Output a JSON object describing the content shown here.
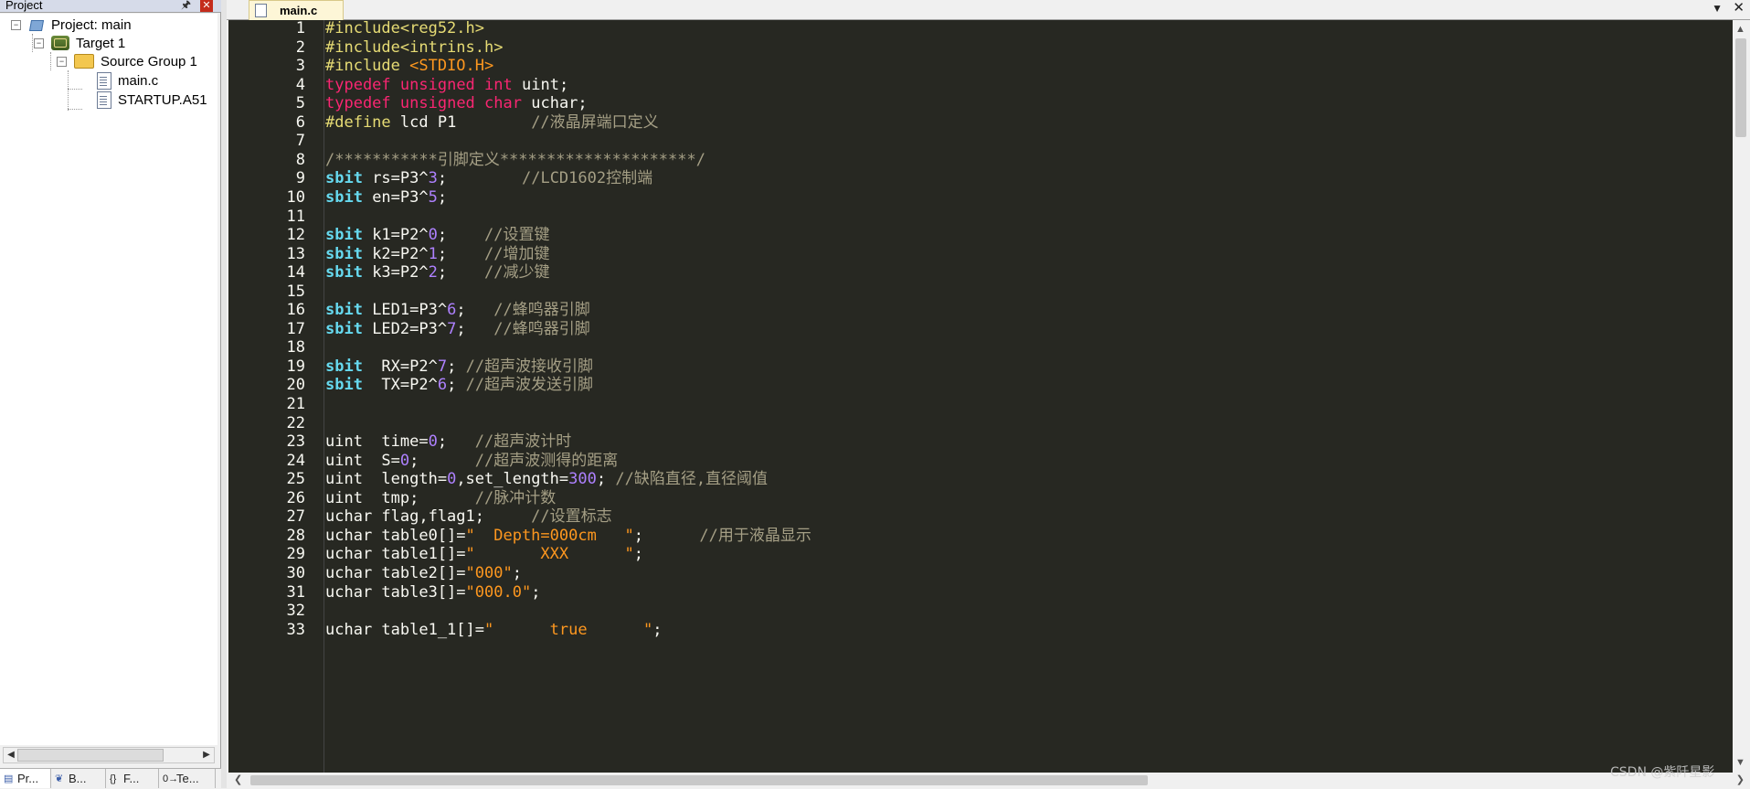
{
  "project_pane": {
    "title": "Project",
    "pin_icon": "pin-icon",
    "close_icon": "close-icon",
    "tree": {
      "root": "Project: main",
      "target": "Target 1",
      "group": "Source Group 1",
      "files": [
        "main.c",
        "STARTUP.A51"
      ]
    },
    "tabs": [
      {
        "label": "Pr...",
        "icon": "project-icon"
      },
      {
        "label": "B...",
        "icon": "books-icon"
      },
      {
        "label": "F...",
        "icon": "functions-icon"
      },
      {
        "label": "Te...",
        "icon": "templates-icon"
      }
    ]
  },
  "editor": {
    "active_tab": "main.c",
    "lines": [
      [
        [
          "pp",
          "#include<reg52.h>"
        ]
      ],
      [
        [
          "pp",
          "#include<intrins.h>"
        ]
      ],
      [
        [
          "pp",
          "#include "
        ],
        [
          "st",
          "<STDIO.H>"
        ]
      ],
      [
        [
          "kw",
          "typedef"
        ],
        [
          "tx",
          " "
        ],
        [
          "kw",
          "unsigned"
        ],
        [
          "tx",
          " "
        ],
        [
          "kw",
          "int"
        ],
        [
          "tx",
          " uint;"
        ]
      ],
      [
        [
          "kw",
          "typedef"
        ],
        [
          "tx",
          " "
        ],
        [
          "kw",
          "unsigned"
        ],
        [
          "tx",
          " "
        ],
        [
          "kw",
          "char"
        ],
        [
          "tx",
          " uchar;"
        ]
      ],
      [
        [
          "pp",
          "#define"
        ],
        [
          "tx",
          " lcd P1        "
        ],
        [
          "cm",
          "//液晶屏端口定义"
        ]
      ],
      [],
      [
        [
          "cm",
          "/***********引脚定义*********************/"
        ]
      ],
      [
        [
          "sb",
          "sbit"
        ],
        [
          "tx",
          " rs=P3^"
        ],
        [
          "nm",
          "3"
        ],
        [
          "tx",
          ";        "
        ],
        [
          "cm",
          "//LCD1602控制端"
        ]
      ],
      [
        [
          "sb",
          "sbit"
        ],
        [
          "tx",
          " en=P3^"
        ],
        [
          "nm",
          "5"
        ],
        [
          "tx",
          ";"
        ]
      ],
      [],
      [
        [
          "sb",
          "sbit"
        ],
        [
          "tx",
          " k1=P2^"
        ],
        [
          "nm",
          "0"
        ],
        [
          "tx",
          ";    "
        ],
        [
          "cm",
          "//设置键"
        ]
      ],
      [
        [
          "sb",
          "sbit"
        ],
        [
          "tx",
          " k2=P2^"
        ],
        [
          "nm",
          "1"
        ],
        [
          "tx",
          ";    "
        ],
        [
          "cm",
          "//增加键"
        ]
      ],
      [
        [
          "sb",
          "sbit"
        ],
        [
          "tx",
          " k3=P2^"
        ],
        [
          "nm",
          "2"
        ],
        [
          "tx",
          ";    "
        ],
        [
          "cm",
          "//减少键"
        ]
      ],
      [],
      [
        [
          "sb",
          "sbit"
        ],
        [
          "tx",
          " LED1=P3^"
        ],
        [
          "nm",
          "6"
        ],
        [
          "tx",
          ";   "
        ],
        [
          "cm",
          "//蜂鸣器引脚"
        ]
      ],
      [
        [
          "sb",
          "sbit"
        ],
        [
          "tx",
          " LED2=P3^"
        ],
        [
          "nm",
          "7"
        ],
        [
          "tx",
          ";   "
        ],
        [
          "cm",
          "//蜂鸣器引脚"
        ]
      ],
      [],
      [
        [
          "sb",
          "sbit"
        ],
        [
          "tx",
          "  RX=P2^"
        ],
        [
          "nm",
          "7"
        ],
        [
          "tx",
          "; "
        ],
        [
          "cm",
          "//超声波接收引脚"
        ]
      ],
      [
        [
          "sb",
          "sbit"
        ],
        [
          "tx",
          "  TX=P2^"
        ],
        [
          "nm",
          "6"
        ],
        [
          "tx",
          "; "
        ],
        [
          "cm",
          "//超声波发送引脚"
        ]
      ],
      [],
      [],
      [
        [
          "tx",
          "uint  time="
        ],
        [
          "nm",
          "0"
        ],
        [
          "tx",
          ";   "
        ],
        [
          "cm",
          "//超声波计时"
        ]
      ],
      [
        [
          "tx",
          "uint  S="
        ],
        [
          "nm",
          "0"
        ],
        [
          "tx",
          ";      "
        ],
        [
          "cm",
          "//超声波测得的距离"
        ]
      ],
      [
        [
          "tx",
          "uint  length="
        ],
        [
          "nm",
          "0"
        ],
        [
          "tx",
          ",set_length="
        ],
        [
          "nm",
          "300"
        ],
        [
          "tx",
          "; "
        ],
        [
          "cm",
          "//缺陷直径,直径阈值"
        ]
      ],
      [
        [
          "tx",
          "uint  tmp;      "
        ],
        [
          "cm",
          "//脉冲计数"
        ]
      ],
      [
        [
          "tx",
          "uchar flag,flag1;     "
        ],
        [
          "cm",
          "//设置标志"
        ]
      ],
      [
        [
          "tx",
          "uchar table0[]="
        ],
        [
          "st",
          "\"  Depth=000cm   \""
        ],
        [
          "tx",
          ";      "
        ],
        [
          "cm",
          "//用于液晶显示"
        ]
      ],
      [
        [
          "tx",
          "uchar table1[]="
        ],
        [
          "st",
          "\"       XXX      \""
        ],
        [
          "tx",
          ";"
        ]
      ],
      [
        [
          "tx",
          "uchar table2[]="
        ],
        [
          "st",
          "\"000\""
        ],
        [
          "tx",
          ";"
        ]
      ],
      [
        [
          "tx",
          "uchar table3[]="
        ],
        [
          "st",
          "\"000.0\""
        ],
        [
          "tx",
          ";"
        ]
      ],
      [],
      [
        [
          "tx",
          "uchar table1_1[]="
        ],
        [
          "st",
          "\"      true      \""
        ],
        [
          "tx",
          ";"
        ]
      ]
    ]
  },
  "watermark": "CSDN @紫阡星影"
}
